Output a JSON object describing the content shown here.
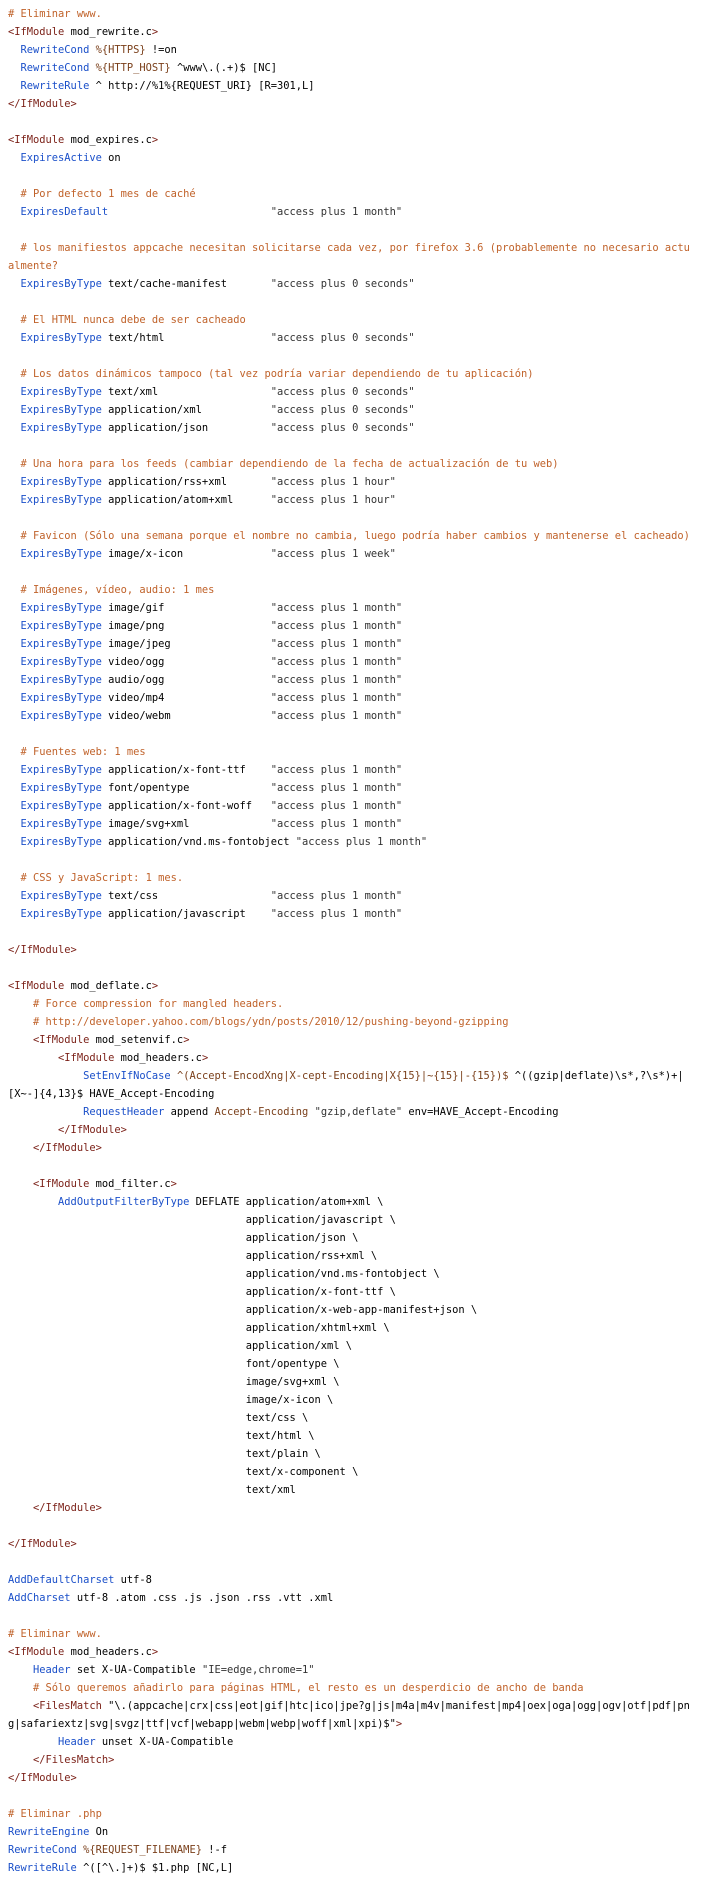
{
  "colors": {
    "comment": "#c0622a",
    "tag": "#7a1f16",
    "keyword": "#1a4fc9",
    "string": "#333333",
    "variable": "#7a3f1a",
    "plain": "#000000",
    "background": "#ffffff"
  },
  "lines": [
    [
      [
        "c",
        "# Eliminar www."
      ]
    ],
    [
      [
        "t",
        "<IfModule"
      ],
      [
        "p",
        " mod_rewrite.c"
      ],
      [
        "t",
        ">"
      ]
    ],
    [
      [
        "p",
        "  "
      ],
      [
        "k",
        "RewriteCond"
      ],
      [
        "p",
        " "
      ],
      [
        "v",
        "%{HTTPS}"
      ],
      [
        "p",
        " !=on"
      ]
    ],
    [
      [
        "p",
        "  "
      ],
      [
        "k",
        "RewriteCond"
      ],
      [
        "p",
        " "
      ],
      [
        "v",
        "%{HTTP_HOST}"
      ],
      [
        "p",
        " ^www\\.(.+)$ [NC]"
      ]
    ],
    [
      [
        "p",
        "  "
      ],
      [
        "k",
        "RewriteRule"
      ],
      [
        "p",
        " ^ http://%1%{REQUEST_URI} [R=301,L]"
      ]
    ],
    [
      [
        "t",
        "</IfModule>"
      ]
    ],
    [
      [
        "p",
        ""
      ]
    ],
    [
      [
        "t",
        "<IfModule"
      ],
      [
        "p",
        " mod_expires.c"
      ],
      [
        "t",
        ">"
      ]
    ],
    [
      [
        "p",
        "  "
      ],
      [
        "k",
        "ExpiresActive"
      ],
      [
        "p",
        " on"
      ]
    ],
    [
      [
        "p",
        ""
      ]
    ],
    [
      [
        "p",
        "  "
      ],
      [
        "c",
        "# Por defecto 1 mes de caché"
      ]
    ],
    [
      [
        "p",
        "  "
      ],
      [
        "k",
        "ExpiresDefault"
      ],
      [
        "p",
        "                          "
      ],
      [
        "s",
        "\"access plus 1 month\""
      ]
    ],
    [
      [
        "p",
        ""
      ]
    ],
    [
      [
        "p",
        "  "
      ],
      [
        "c",
        "# los manifiestos appcache necesitan solicitarse cada vez, por firefox 3.6 (probablemente no necesario actualmente?"
      ]
    ],
    [
      [
        "p",
        "  "
      ],
      [
        "k",
        "ExpiresByType"
      ],
      [
        "p",
        " text/cache-manifest       "
      ],
      [
        "s",
        "\"access plus 0 seconds\""
      ]
    ],
    [
      [
        "p",
        ""
      ]
    ],
    [
      [
        "p",
        "  "
      ],
      [
        "c",
        "# El HTML nunca debe de ser cacheado"
      ]
    ],
    [
      [
        "p",
        "  "
      ],
      [
        "k",
        "ExpiresByType"
      ],
      [
        "p",
        " text/html                 "
      ],
      [
        "s",
        "\"access plus 0 seconds\""
      ]
    ],
    [
      [
        "p",
        ""
      ]
    ],
    [
      [
        "p",
        "  "
      ],
      [
        "c",
        "# Los datos dinámicos tampoco (tal vez podría variar dependiendo de tu aplicación)"
      ]
    ],
    [
      [
        "p",
        "  "
      ],
      [
        "k",
        "ExpiresByType"
      ],
      [
        "p",
        " text/xml                  "
      ],
      [
        "s",
        "\"access plus 0 seconds\""
      ]
    ],
    [
      [
        "p",
        "  "
      ],
      [
        "k",
        "ExpiresByType"
      ],
      [
        "p",
        " application/xml           "
      ],
      [
        "s",
        "\"access plus 0 seconds\""
      ]
    ],
    [
      [
        "p",
        "  "
      ],
      [
        "k",
        "ExpiresByType"
      ],
      [
        "p",
        " application/json          "
      ],
      [
        "s",
        "\"access plus 0 seconds\""
      ]
    ],
    [
      [
        "p",
        ""
      ]
    ],
    [
      [
        "p",
        "  "
      ],
      [
        "c",
        "# Una hora para los feeds (cambiar dependiendo de la fecha de actualización de tu web)"
      ]
    ],
    [
      [
        "p",
        "  "
      ],
      [
        "k",
        "ExpiresByType"
      ],
      [
        "p",
        " application/rss+xml       "
      ],
      [
        "s",
        "\"access plus 1 hour\""
      ]
    ],
    [
      [
        "p",
        "  "
      ],
      [
        "k",
        "ExpiresByType"
      ],
      [
        "p",
        " application/atom+xml      "
      ],
      [
        "s",
        "\"access plus 1 hour\""
      ]
    ],
    [
      [
        "p",
        ""
      ]
    ],
    [
      [
        "p",
        "  "
      ],
      [
        "c",
        "# Favicon (Sólo una semana porque el nombre no cambia, luego podría haber cambios y mantenerse el cacheado)"
      ]
    ],
    [
      [
        "p",
        "  "
      ],
      [
        "k",
        "ExpiresByType"
      ],
      [
        "p",
        " image/x-icon              "
      ],
      [
        "s",
        "\"access plus 1 week\""
      ]
    ],
    [
      [
        "p",
        ""
      ]
    ],
    [
      [
        "p",
        "  "
      ],
      [
        "c",
        "# Imágenes, vídeo, audio: 1 mes"
      ]
    ],
    [
      [
        "p",
        "  "
      ],
      [
        "k",
        "ExpiresByType"
      ],
      [
        "p",
        " image/gif                 "
      ],
      [
        "s",
        "\"access plus 1 month\""
      ]
    ],
    [
      [
        "p",
        "  "
      ],
      [
        "k",
        "ExpiresByType"
      ],
      [
        "p",
        " image/png                 "
      ],
      [
        "s",
        "\"access plus 1 month\""
      ]
    ],
    [
      [
        "p",
        "  "
      ],
      [
        "k",
        "ExpiresByType"
      ],
      [
        "p",
        " image/jpeg                "
      ],
      [
        "s",
        "\"access plus 1 month\""
      ]
    ],
    [
      [
        "p",
        "  "
      ],
      [
        "k",
        "ExpiresByType"
      ],
      [
        "p",
        " video/ogg                 "
      ],
      [
        "s",
        "\"access plus 1 month\""
      ]
    ],
    [
      [
        "p",
        "  "
      ],
      [
        "k",
        "ExpiresByType"
      ],
      [
        "p",
        " audio/ogg                 "
      ],
      [
        "s",
        "\"access plus 1 month\""
      ]
    ],
    [
      [
        "p",
        "  "
      ],
      [
        "k",
        "ExpiresByType"
      ],
      [
        "p",
        " video/mp4                 "
      ],
      [
        "s",
        "\"access plus 1 month\""
      ]
    ],
    [
      [
        "p",
        "  "
      ],
      [
        "k",
        "ExpiresByType"
      ],
      [
        "p",
        " video/webm                "
      ],
      [
        "s",
        "\"access plus 1 month\""
      ]
    ],
    [
      [
        "p",
        ""
      ]
    ],
    [
      [
        "p",
        "  "
      ],
      [
        "c",
        "# Fuentes web: 1 mes"
      ]
    ],
    [
      [
        "p",
        "  "
      ],
      [
        "k",
        "ExpiresByType"
      ],
      [
        "p",
        " application/x-font-ttf    "
      ],
      [
        "s",
        "\"access plus 1 month\""
      ]
    ],
    [
      [
        "p",
        "  "
      ],
      [
        "k",
        "ExpiresByType"
      ],
      [
        "p",
        " font/opentype             "
      ],
      [
        "s",
        "\"access plus 1 month\""
      ]
    ],
    [
      [
        "p",
        "  "
      ],
      [
        "k",
        "ExpiresByType"
      ],
      [
        "p",
        " application/x-font-woff   "
      ],
      [
        "s",
        "\"access plus 1 month\""
      ]
    ],
    [
      [
        "p",
        "  "
      ],
      [
        "k",
        "ExpiresByType"
      ],
      [
        "p",
        " image/svg+xml             "
      ],
      [
        "s",
        "\"access plus 1 month\""
      ]
    ],
    [
      [
        "p",
        "  "
      ],
      [
        "k",
        "ExpiresByType"
      ],
      [
        "p",
        " application/vnd.ms-fontobject "
      ],
      [
        "s",
        "\"access plus 1 month\""
      ]
    ],
    [
      [
        "p",
        ""
      ]
    ],
    [
      [
        "p",
        "  "
      ],
      [
        "c",
        "# CSS y JavaScript: 1 mes."
      ]
    ],
    [
      [
        "p",
        "  "
      ],
      [
        "k",
        "ExpiresByType"
      ],
      [
        "p",
        " text/css                  "
      ],
      [
        "s",
        "\"access plus 1 month\""
      ]
    ],
    [
      [
        "p",
        "  "
      ],
      [
        "k",
        "ExpiresByType"
      ],
      [
        "p",
        " application/javascript    "
      ],
      [
        "s",
        "\"access plus 1 month\""
      ]
    ],
    [
      [
        "p",
        ""
      ]
    ],
    [
      [
        "t",
        "</IfModule>"
      ]
    ],
    [
      [
        "p",
        ""
      ]
    ],
    [
      [
        "t",
        "<IfModule"
      ],
      [
        "p",
        " mod_deflate.c"
      ],
      [
        "t",
        ">"
      ]
    ],
    [
      [
        "p",
        "    "
      ],
      [
        "c",
        "# Force compression for mangled headers."
      ]
    ],
    [
      [
        "p",
        "    "
      ],
      [
        "c",
        "# http://developer.yahoo.com/blogs/ydn/posts/2010/12/pushing-beyond-gzipping"
      ]
    ],
    [
      [
        "p",
        "    "
      ],
      [
        "t",
        "<IfModule"
      ],
      [
        "p",
        " mod_setenvif.c"
      ],
      [
        "t",
        ">"
      ]
    ],
    [
      [
        "p",
        "        "
      ],
      [
        "t",
        "<IfModule"
      ],
      [
        "p",
        " mod_headers.c"
      ],
      [
        "t",
        ">"
      ]
    ],
    [
      [
        "p",
        "            "
      ],
      [
        "k",
        "SetEnvIfNoCase"
      ],
      [
        "p",
        " "
      ],
      [
        "v",
        "^(Accept-EncodXng|X-cept-Encoding|X{15}|~{15}|-{15})$"
      ],
      [
        "p",
        " ^((gzip|deflate)\\s*,?\\s*)+|[X~-]{4,13}$ HAVE_Accept-Encoding"
      ]
    ],
    [
      [
        "p",
        "            "
      ],
      [
        "k",
        "RequestHeader"
      ],
      [
        "p",
        " append "
      ],
      [
        "v",
        "Accept-Encoding"
      ],
      [
        "p",
        " "
      ],
      [
        "s",
        "\"gzip,deflate\""
      ],
      [
        "p",
        " env=HAVE_Accept-Encoding"
      ]
    ],
    [
      [
        "p",
        "        "
      ],
      [
        "t",
        "</IfModule>"
      ]
    ],
    [
      [
        "p",
        "    "
      ],
      [
        "t",
        "</IfModule>"
      ]
    ],
    [
      [
        "p",
        ""
      ]
    ],
    [
      [
        "p",
        "    "
      ],
      [
        "t",
        "<IfModule"
      ],
      [
        "p",
        " mod_filter.c"
      ],
      [
        "t",
        ">"
      ]
    ],
    [
      [
        "p",
        "        "
      ],
      [
        "k",
        "AddOutputFilterByType"
      ],
      [
        "p",
        " DEFLATE application/atom+xml \\"
      ]
    ],
    [
      [
        "p",
        "                                      application/javascript \\"
      ]
    ],
    [
      [
        "p",
        "                                      application/json \\"
      ]
    ],
    [
      [
        "p",
        "                                      application/rss+xml \\"
      ]
    ],
    [
      [
        "p",
        "                                      application/vnd.ms-fontobject \\"
      ]
    ],
    [
      [
        "p",
        "                                      application/x-font-ttf \\"
      ]
    ],
    [
      [
        "p",
        "                                      application/x-web-app-manifest+json \\"
      ]
    ],
    [
      [
        "p",
        "                                      application/xhtml+xml \\"
      ]
    ],
    [
      [
        "p",
        "                                      application/xml \\"
      ]
    ],
    [
      [
        "p",
        "                                      font/opentype \\"
      ]
    ],
    [
      [
        "p",
        "                                      image/svg+xml \\"
      ]
    ],
    [
      [
        "p",
        "                                      image/x-icon \\"
      ]
    ],
    [
      [
        "p",
        "                                      text/css \\"
      ]
    ],
    [
      [
        "p",
        "                                      text/html \\"
      ]
    ],
    [
      [
        "p",
        "                                      text/plain \\"
      ]
    ],
    [
      [
        "p",
        "                                      text/x-component \\"
      ]
    ],
    [
      [
        "p",
        "                                      text/xml"
      ]
    ],
    [
      [
        "p",
        "    "
      ],
      [
        "t",
        "</IfModule>"
      ]
    ],
    [
      [
        "p",
        ""
      ]
    ],
    [
      [
        "t",
        "</IfModule>"
      ]
    ],
    [
      [
        "p",
        ""
      ]
    ],
    [
      [
        "k",
        "AddDefaultCharset"
      ],
      [
        "p",
        " utf-8"
      ]
    ],
    [
      [
        "k",
        "AddCharset"
      ],
      [
        "p",
        " utf-8 .atom .css .js .json .rss .vtt .xml"
      ]
    ],
    [
      [
        "p",
        ""
      ]
    ],
    [
      [
        "c",
        "# Eliminar www."
      ]
    ],
    [
      [
        "t",
        "<IfModule"
      ],
      [
        "p",
        " mod_headers.c"
      ],
      [
        "t",
        ">"
      ]
    ],
    [
      [
        "p",
        "    "
      ],
      [
        "k",
        "Header"
      ],
      [
        "p",
        " set X-UA-Compatible "
      ],
      [
        "s",
        "\"IE=edge,chrome=1\""
      ]
    ],
    [
      [
        "p",
        "    "
      ],
      [
        "c",
        "# Sólo queremos añadirlo para páginas HTML, el resto es un desperdicio de ancho de banda"
      ]
    ],
    [
      [
        "p",
        "    "
      ],
      [
        "t",
        "<FilesMatch"
      ],
      [
        "p",
        " \"\\.(appcache|crx|css|eot|gif|htc|ico|jpe?g|js|m4a|m4v|manifest|mp4|oex|oga|ogg|ogv|otf|pdf|png|safariextz|svg|svgz|ttf|vcf|webapp|webm|webp|woff|xml|xpi)$\""
      ],
      [
        "t",
        ">"
      ]
    ],
    [
      [
        "p",
        "        "
      ],
      [
        "k",
        "Header"
      ],
      [
        "p",
        " unset X-UA-Compatible"
      ]
    ],
    [
      [
        "p",
        "    "
      ],
      [
        "t",
        "</FilesMatch>"
      ]
    ],
    [
      [
        "t",
        "</IfModule>"
      ]
    ],
    [
      [
        "p",
        ""
      ]
    ],
    [
      [
        "c",
        "# Eliminar .php"
      ]
    ],
    [
      [
        "k",
        "RewriteEngine"
      ],
      [
        "p",
        " On"
      ]
    ],
    [
      [
        "k",
        "RewriteCond"
      ],
      [
        "p",
        " "
      ],
      [
        "v",
        "%{REQUEST_FILENAME}"
      ],
      [
        "p",
        " !-f"
      ]
    ],
    [
      [
        "k",
        "RewriteRule"
      ],
      [
        "p",
        " ^([^\\.]+)$ $1.php [NC,L]"
      ]
    ]
  ]
}
